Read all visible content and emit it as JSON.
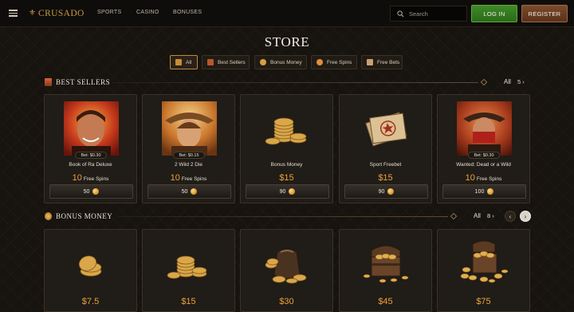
{
  "header": {
    "logo_text": "CRUSADO",
    "nav": [
      "SPORTS",
      "CASINO",
      "BONUSES"
    ],
    "search_placeholder": "Search",
    "login_label": "LOG IN",
    "register_label": "REGISTER"
  },
  "page_title": "STORE",
  "filters": [
    {
      "label": "All",
      "icon": "grid-icon",
      "color": "#c98a3a",
      "active": true
    },
    {
      "label": "Best Sellers",
      "icon": "star-icon",
      "color": "#b8572a",
      "active": false
    },
    {
      "label": "Bonus Money",
      "icon": "coins-icon",
      "color": "#d4a040",
      "active": false
    },
    {
      "label": "Free Spins",
      "icon": "spin-icon",
      "color": "#e09038",
      "active": false
    },
    {
      "label": "Free Bets",
      "icon": "ticket-icon",
      "color": "#c9a070",
      "active": false
    }
  ],
  "best_sellers": {
    "title": "BEST SELLERS",
    "all_label": "All",
    "count": "5",
    "items": [
      {
        "bet": "Bet: $0.30",
        "name": "Book of Ra Deluxe",
        "amount": "10",
        "unit": "Free Spins",
        "price": "50",
        "art": "portrait-red"
      },
      {
        "bet": "Bet: $0.15",
        "name": "2 Wild 2 Die",
        "amount": "10",
        "unit": "Free Spins",
        "price": "50",
        "art": "portrait-cowboy"
      },
      {
        "bet": "",
        "name": "Bonus Money",
        "amount": "$15",
        "unit": "",
        "price": "90",
        "art": "coins"
      },
      {
        "bet": "",
        "name": "Sport Freebet",
        "amount": "$15",
        "unit": "",
        "price": "90",
        "art": "tickets"
      },
      {
        "bet": "Bet: $0.30",
        "name": "Wanted: Dead or a Wild",
        "amount": "10",
        "unit": "Free Spins",
        "price": "100",
        "art": "portrait-bandit"
      }
    ]
  },
  "bonus_money": {
    "title": "BONUS MONEY",
    "all_label": "All",
    "count": "8",
    "items": [
      {
        "price": "$7.5",
        "art": "coins-small"
      },
      {
        "price": "$15",
        "art": "coins"
      },
      {
        "price": "$30",
        "art": "coin-bag"
      },
      {
        "price": "$45",
        "art": "chest"
      },
      {
        "price": "$75",
        "art": "chest-big"
      }
    ]
  }
}
